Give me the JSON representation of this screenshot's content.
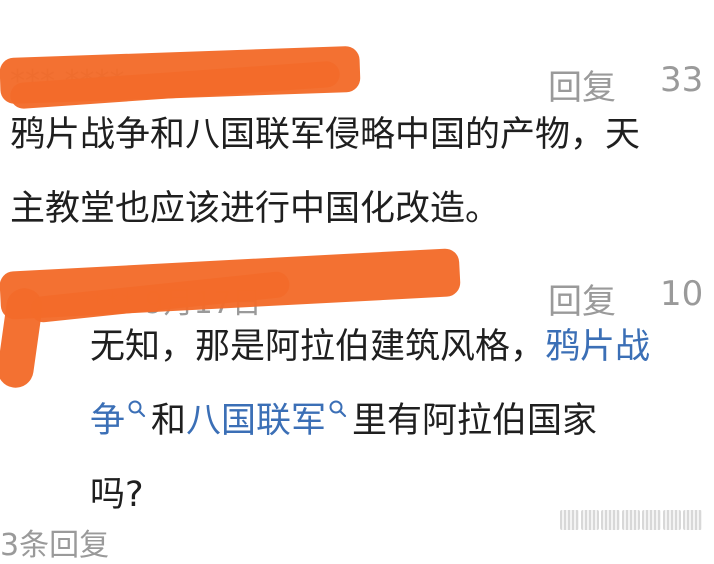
{
  "comments": [
    {
      "username": "*** ****",
      "reply_label": "回复",
      "likes": "33",
      "text_lines": [
        "鸦片战争和八国联军侵略中国的产物，天",
        "主教堂也应该进行中国化改造。"
      ]
    },
    {
      "username": "*** 9月17日",
      "reply_label": "回复",
      "likes": "10",
      "line1_plain": "无知，那是阿拉伯建筑风格，",
      "link1_part1": "鸦片战",
      "link1_part2": "争",
      "connector": "和",
      "link2": "八国联军",
      "line2_rest": "里有阿拉伯国家",
      "line3": "吗?"
    }
  ],
  "more_replies": "3条回复",
  "colors": {
    "link": "#3b6fb6",
    "meta": "#9a9a9a",
    "redaction": "#f36b2a"
  }
}
